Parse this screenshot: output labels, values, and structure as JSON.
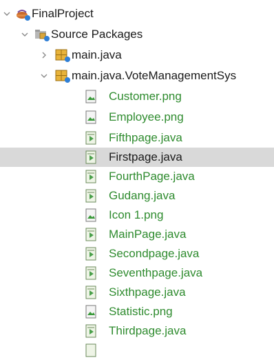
{
  "tree": {
    "project": {
      "label": "FinalProject",
      "icon": "coffee-cup-project-icon",
      "expanded": true
    },
    "source_packages": {
      "label": "Source Packages",
      "icon": "folder-packages-icon",
      "expanded": true
    },
    "packages": [
      {
        "label": "main.java",
        "icon": "package-icon",
        "expanded": false
      },
      {
        "label": "main.java.VoteManagementSys",
        "icon": "package-icon",
        "expanded": true
      }
    ],
    "files": [
      {
        "label": "Customer.png",
        "icon": "image-file-icon"
      },
      {
        "label": "Employee.png",
        "icon": "image-file-icon"
      },
      {
        "label": "Fifthpage.java",
        "icon": "java-file-icon"
      },
      {
        "label": "Firstpage.java",
        "icon": "java-file-icon",
        "selected": true
      },
      {
        "label": "FourthPage.java",
        "icon": "java-file-icon"
      },
      {
        "label": "Gudang.java",
        "icon": "java-file-icon"
      },
      {
        "label": "Icon 1.png",
        "icon": "image-file-icon"
      },
      {
        "label": "MainPage.java",
        "icon": "java-file-icon"
      },
      {
        "label": "Secondpage.java",
        "icon": "java-file-icon"
      },
      {
        "label": "Seventhpage.java",
        "icon": "java-file-icon"
      },
      {
        "label": "Sixthpage.java",
        "icon": "java-file-icon"
      },
      {
        "label": "Statistic.png",
        "icon": "image-file-icon"
      },
      {
        "label": "Thirdpage.java",
        "icon": "java-file-icon"
      }
    ]
  },
  "colors": {
    "modified_text": "#2e8b2e",
    "selection": "#d9d9d9",
    "badge": "#2f7fd6"
  }
}
